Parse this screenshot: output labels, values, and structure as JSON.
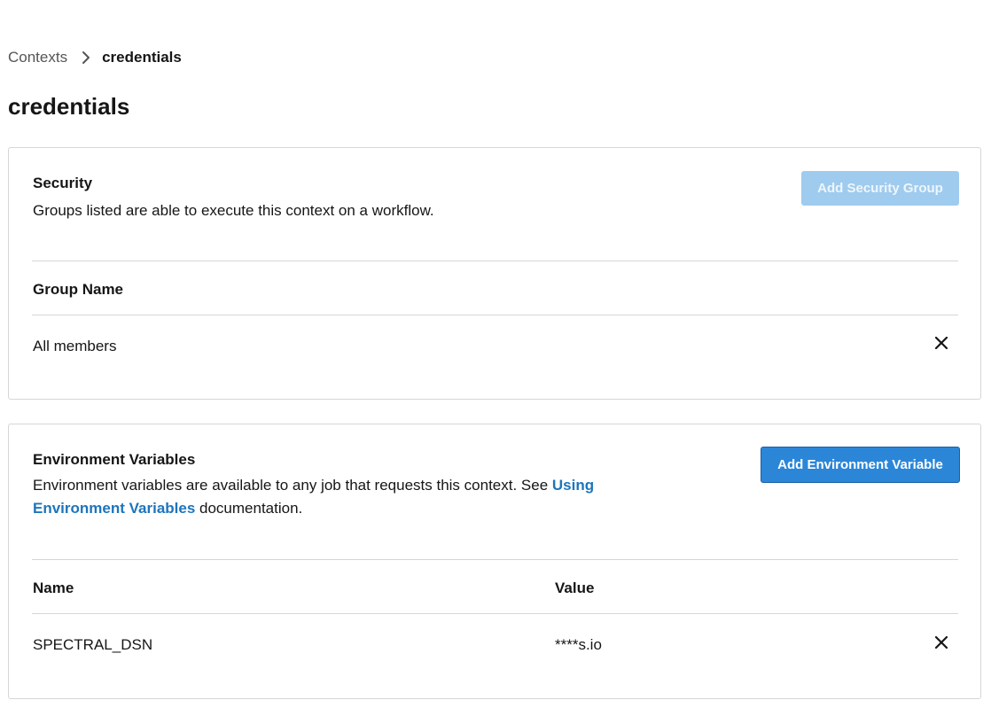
{
  "breadcrumb": {
    "parent": "Contexts",
    "current": "credentials"
  },
  "page_title": "credentials",
  "security": {
    "title": "Security",
    "description": "Groups listed are able to execute this context on a workflow.",
    "add_button": "Add Security Group",
    "add_button_disabled": true,
    "columns": [
      "Group Name"
    ],
    "rows": [
      {
        "group_name": "All members"
      }
    ]
  },
  "env": {
    "title": "Environment Variables",
    "description_prefix": "Environment variables are available to any job that requests this context. See ",
    "description_link": "Using Environment Variables",
    "description_suffix": " documentation.",
    "add_button": "Add Environment Variable",
    "columns": [
      "Name",
      "Value"
    ],
    "rows": [
      {
        "name": "SPECTRAL_DSN",
        "value": "****s.io"
      }
    ]
  },
  "colors": {
    "primary_button": "#2b86d8",
    "disabled_button": "#9fcbee",
    "link": "#1d75bc",
    "border": "#d6d6d6"
  },
  "icons": [
    "chevron-right-icon",
    "close-icon"
  ]
}
